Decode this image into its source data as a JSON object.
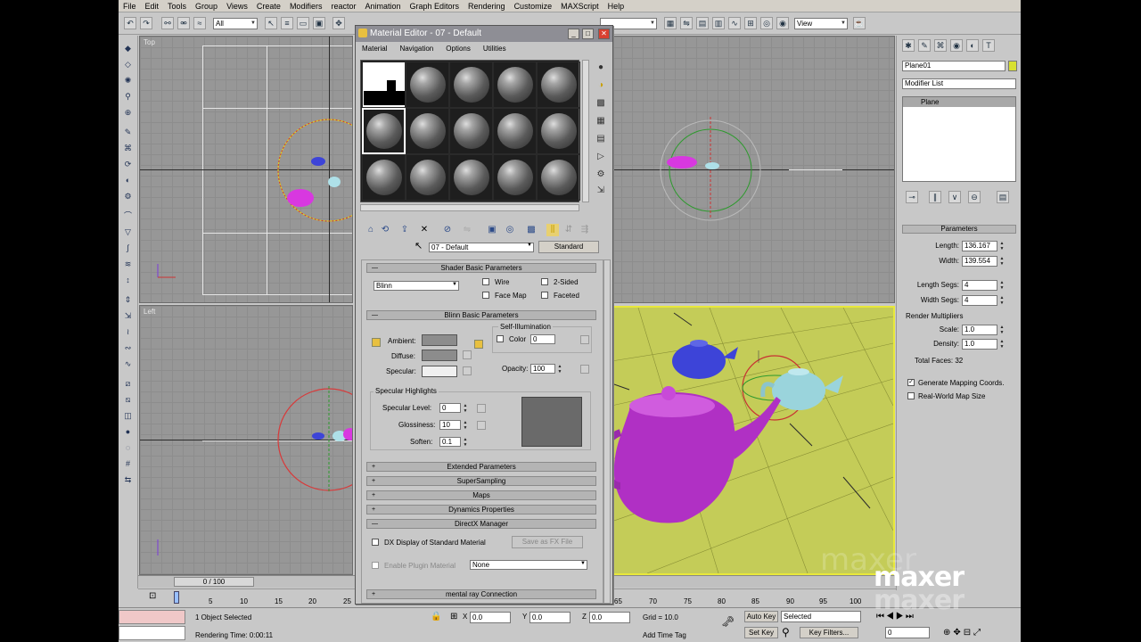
{
  "app": {
    "menu": [
      "File",
      "Edit",
      "Tools",
      "Group",
      "Views",
      "Create",
      "Modifiers",
      "reactor",
      "Animation",
      "Graph Editors",
      "Rendering",
      "Customize",
      "MAXScript",
      "Help"
    ]
  },
  "toolbar": {
    "selection_filter": "All",
    "view_dropdown": "View"
  },
  "viewports": {
    "top_label": "Top",
    "left_label": "Left"
  },
  "material_editor": {
    "title": "Material Editor - 07 - Default",
    "menu": [
      "Material",
      "Navigation",
      "Options",
      "Utilities"
    ],
    "material_name": "07 - Default",
    "material_type": "Standard",
    "shader_rollout": "Shader Basic Parameters",
    "shader": "Blinn",
    "opt_wire": "Wire",
    "opt_2sided": "2-Sided",
    "opt_facemap": "Face Map",
    "opt_faceted": "Faceted",
    "blinn_rollout": "Blinn Basic Parameters",
    "self_illum_label": "Self-Illumination",
    "color_label": "Color",
    "color_value": "0",
    "ambient_label": "Ambient:",
    "diffuse_label": "Diffuse:",
    "specular_label": "Specular:",
    "opacity_label": "Opacity:",
    "opacity_value": "100",
    "spec_highlights_label": "Specular Highlights",
    "spec_level_label": "Specular Level:",
    "spec_level_value": "0",
    "glossiness_label": "Glossiness:",
    "glossiness_value": "10",
    "soften_label": "Soften:",
    "soften_value": "0.1",
    "rollouts": [
      "Extended Parameters",
      "SuperSampling",
      "Maps",
      "Dynamics Properties"
    ],
    "directx_rollout": "DirectX Manager",
    "dx_display_label": "DX Display of Standard Material",
    "save_fx_label": "Save as FX File",
    "enable_plugin_label": "Enable Plugin Material",
    "plugin_value": "None",
    "mental_ray_rollout": "mental ray Connection"
  },
  "command_panel": {
    "object_name": "Plane01",
    "modifier_list": "Modifier List",
    "stack_item": "Plane",
    "params_rollout": "Parameters",
    "length_label": "Length:",
    "length_value": "136.167",
    "width_label": "Width:",
    "width_value": "139.554",
    "length_segs_label": "Length Segs:",
    "length_segs_value": "4",
    "width_segs_label": "Width Segs:",
    "width_segs_value": "4",
    "render_mult_label": "Render Multipliers",
    "scale_label": "Scale:",
    "scale_value": "1.0",
    "density_label": "Density:",
    "density_value": "1.0",
    "total_faces": "Total Faces: 32",
    "gen_mapping_label": "Generate Mapping Coords.",
    "realworld_label": "Real-World Map Size"
  },
  "timeline": {
    "frame": "0 / 100",
    "ticks": [
      "5",
      "10",
      "15",
      "20",
      "25",
      "65",
      "70",
      "75",
      "80",
      "85",
      "90",
      "95",
      "100"
    ]
  },
  "status": {
    "selected": "1 Object Selected",
    "rendering_time": "Rendering Time: 0:00:11",
    "x_label": "X",
    "x_value": "0.0",
    "y_label": "Y",
    "y_value": "0.0",
    "z_label": "Z",
    "z_value": "0.0",
    "grid": "Grid = 10.0",
    "add_time_tag": "Add Time Tag",
    "auto_key": "Auto Key",
    "set_key": "Set Key",
    "selected_dropdown": "Selected",
    "key_filters": "Key Filters...",
    "frame_field": "0"
  },
  "watermark": {
    "text": "maxer",
    "shadow_text": "maxer",
    "faint_text": "maxer"
  },
  "colors": {
    "perspective_bg": "#c4cc58",
    "teapot_large": "#b832c8",
    "teapot_blue": "#4a55c8",
    "teapot_cyan": "#9ad4dc"
  }
}
